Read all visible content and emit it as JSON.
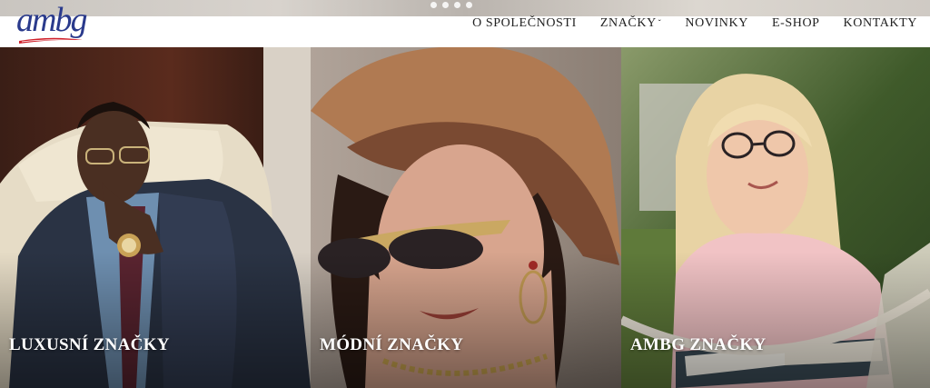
{
  "brand": {
    "logo_text": "ambg",
    "logo_color": "#2a3a8c",
    "swoosh_color": "#d0202a"
  },
  "nav": {
    "items": [
      {
        "label": "O SPOLEČNOSTI"
      },
      {
        "label": "ZNAČKY",
        "has_dropdown": true
      },
      {
        "label": "NOVINKY"
      },
      {
        "label": "E-SHOP"
      },
      {
        "label": "KONTAKTY"
      }
    ]
  },
  "carousel": {
    "dot_count": 4
  },
  "panels": [
    {
      "label": "LUXUSNÍ ZNAČKY"
    },
    {
      "label": "MÓDNÍ ZNAČKY"
    },
    {
      "label": "AMBG ZNAČKY"
    }
  ]
}
